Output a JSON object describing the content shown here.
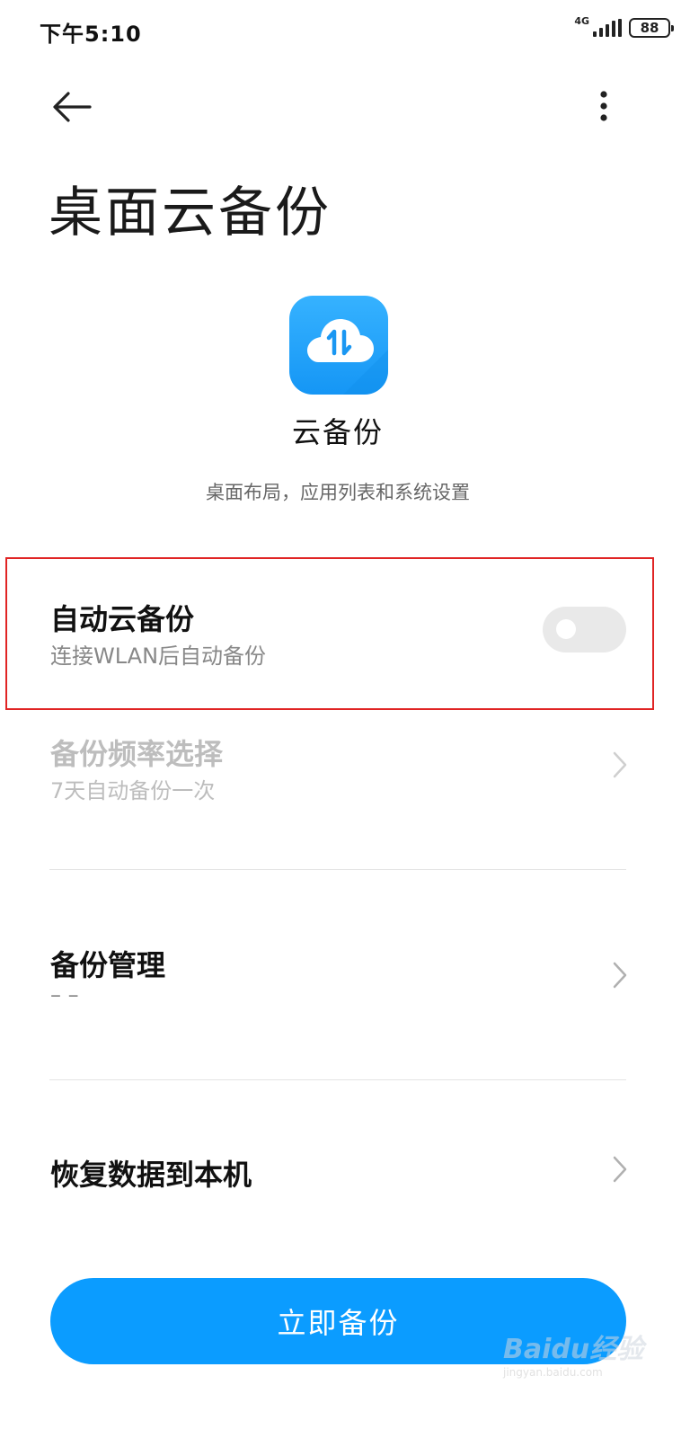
{
  "status_bar": {
    "time": "下午5:10",
    "network": "4G",
    "battery": "88"
  },
  "header": {
    "back_icon": "arrow-left-icon",
    "more_icon": "more-vertical-icon",
    "title": "桌面云备份"
  },
  "app": {
    "icon": "cloud-sync-icon",
    "name": "云备份",
    "description": "桌面布局，应用列表和系统设置"
  },
  "settings": {
    "auto_backup": {
      "title": "自动云备份",
      "subtitle": "连接WLAN后自动备份",
      "enabled": false
    },
    "frequency": {
      "title": "备份频率选择",
      "subtitle": "7天自动备份一次"
    },
    "manage": {
      "title": "备份管理",
      "subtitle": "– –"
    },
    "restore": {
      "title": "恢复数据到本机"
    }
  },
  "actions": {
    "backup_now": "立即备份"
  },
  "watermark": {
    "brand": "Baidu经验",
    "url": "jingyan.baidu.com"
  },
  "colors": {
    "accent": "#0b9cff",
    "highlight_border": "#e02424"
  }
}
